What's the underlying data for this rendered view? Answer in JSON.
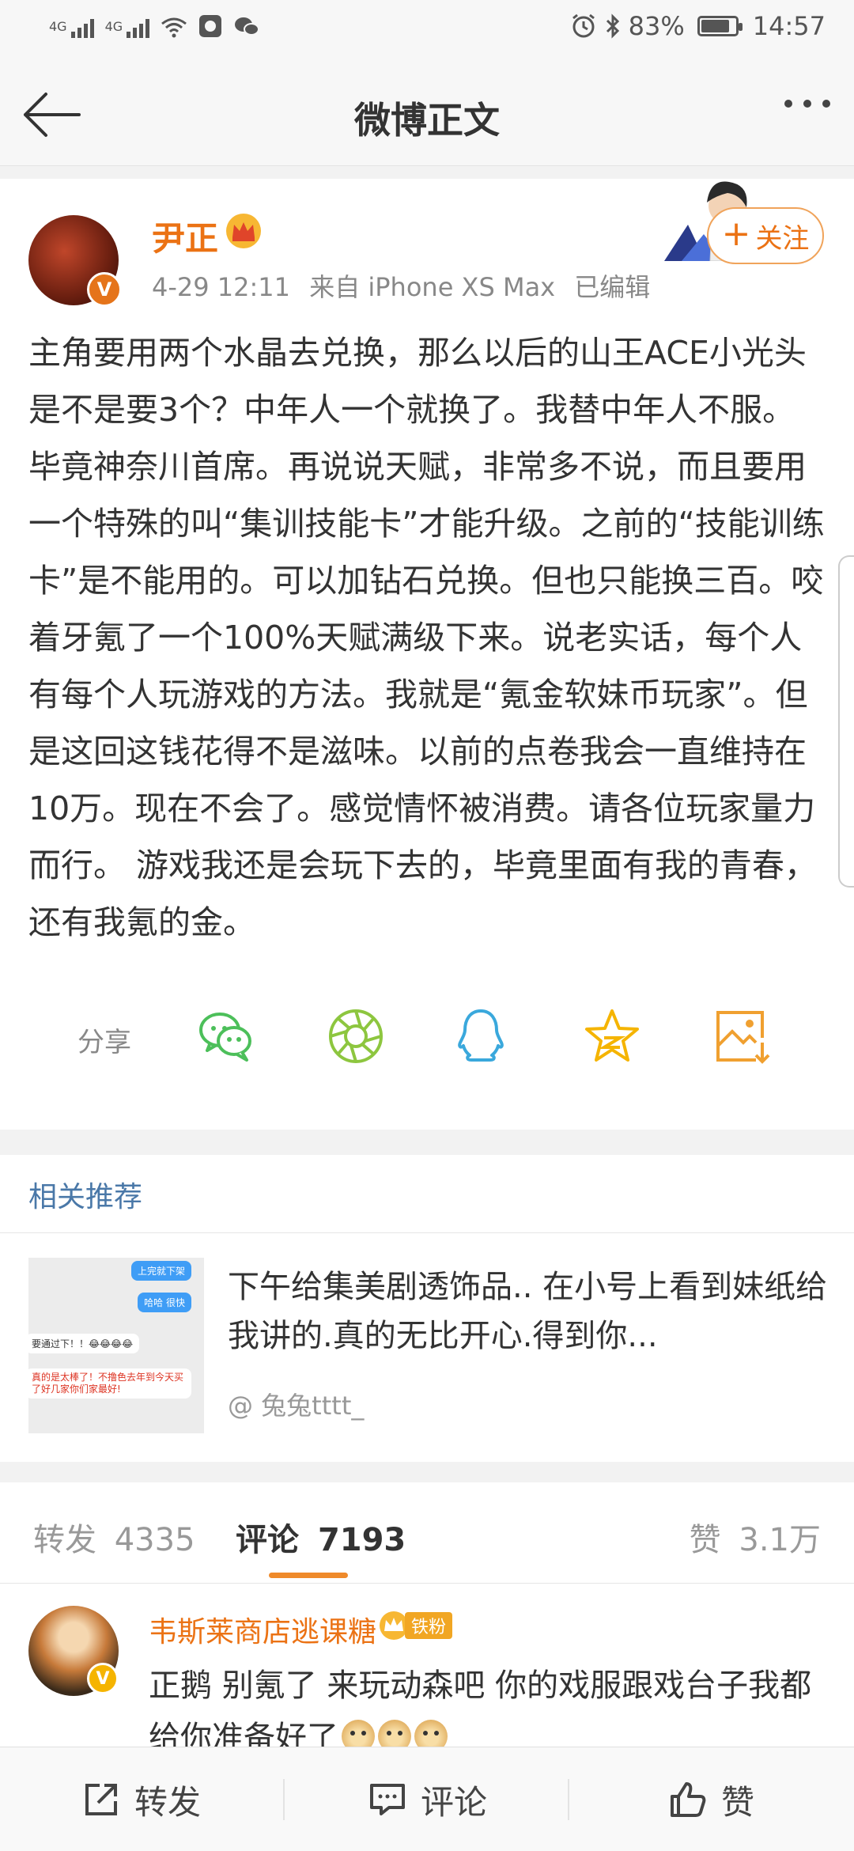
{
  "status_bar": {
    "network1": "4G",
    "network2": "4G",
    "battery_percent": "83%",
    "battery_level": 0.83,
    "time": "14:57"
  },
  "nav": {
    "title": "微博正文"
  },
  "post": {
    "author": "尹正",
    "date": "4-29 12:11",
    "source": "来自 iPhone XS Max",
    "edited": "已编辑",
    "follow_label": "关注",
    "text": "主角要用两个水晶去兑换，那么以后的山王ACE小光头是不是要3个？中年人一个就换了。我替中年人不服。毕竟神奈川首席。再说说天赋，非常多不说，而且要用一个特殊的叫“集训技能卡”才能升级。之前的“技能训练卡”是不能用的。可以加钻石兑换。但也只能换三百。咬着牙氪了一个100%天赋满级下来。说老实话，每个人有每个人玩游戏的方法。我就是“氪金软妹币玩家”。但是这回这钱花得不是滋味。以前的点卷我会一直维持在10万。现在不会了。感觉情怀被消费。请各位玩家量力而行。 游戏我还是会玩下去的，毕竟里面有我的青春，还有我氪的金。",
    "vip_badge": "V"
  },
  "share": {
    "label": "分享",
    "targets": [
      "wechat-icon",
      "moments-icon",
      "qq-icon",
      "favorite-icon",
      "save-image-icon"
    ]
  },
  "related": {
    "title": "相关推荐",
    "item_text": "下午给集美剧透饰品.. 在小号上看到妹纸给我讲的.真的无比开心.得到你...",
    "item_author": "@ 兔兔tttt_",
    "thumb_chat": [
      "上完就下架",
      "哈哈 很快",
      "要通过下！！😂😂😂😂",
      "真的是太棒了！不撸色去年到今天买了好几家你们家最好!"
    ]
  },
  "tabs": {
    "repost_label": "转发",
    "repost_count": "4335",
    "comment_label": "评论",
    "comment_count": "7193",
    "like_label": "赞",
    "like_count": "3.1万"
  },
  "comment": {
    "name": "韦斯莱商店逃课糖",
    "fan_badge": "铁粉",
    "vip_badge": "V",
    "text": "正鹅 别氪了 来玩动森吧 你的戏服跟戏台子我都给你准备好了"
  },
  "bottom_bar": {
    "repost": "转发",
    "comment": "评论",
    "like": "赞"
  },
  "colors": {
    "accent_orange": "#eb7214",
    "link_blue": "#4a78a8",
    "wechat_green": "#4cbf5a",
    "moments_green": "#8dc63f",
    "qq_blue": "#3aa8dc",
    "favorite_yellow": "#f5b400",
    "save_orange": "#f0a030"
  }
}
